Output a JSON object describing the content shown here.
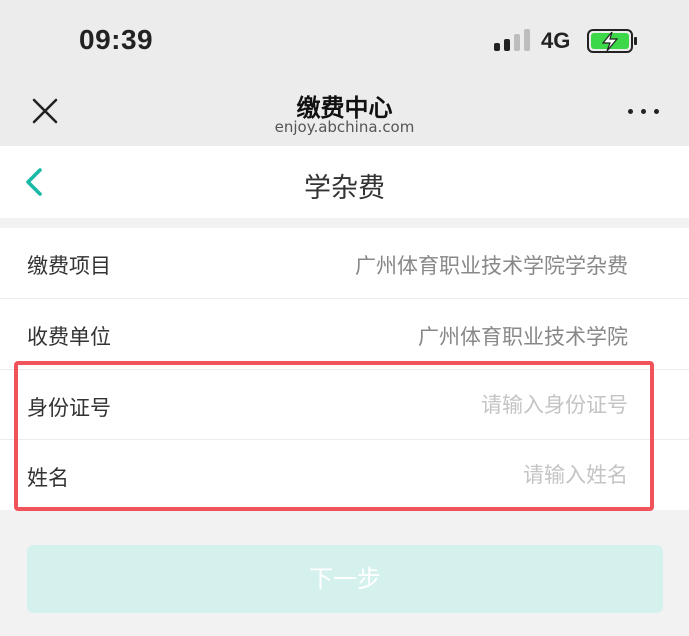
{
  "status_bar": {
    "time": "09:39",
    "network": "4G",
    "icons": [
      "signal-icon",
      "battery-charging-icon"
    ]
  },
  "nav_bar": {
    "title": "缴费中心",
    "url": "enjoy.abchina.com",
    "icons": [
      "close-icon",
      "more-icon"
    ]
  },
  "page": {
    "title": "学杂费",
    "back_icon": "chevron-left-icon",
    "accent_color": "#1bb8a6"
  },
  "form": {
    "rows": [
      {
        "label": "缴费项目",
        "value": "广州体育职业技术学院学杂费"
      },
      {
        "label": "收费单位",
        "value": "广州体育职业技术学院"
      },
      {
        "label": "身份证号",
        "placeholder": "请输入身份证号",
        "value": ""
      },
      {
        "label": "姓名",
        "placeholder": "请输入姓名",
        "value": ""
      }
    ],
    "highlight_color": "#f0535a"
  },
  "next_button": {
    "label": "下一步",
    "background": "#d4f1ee"
  }
}
